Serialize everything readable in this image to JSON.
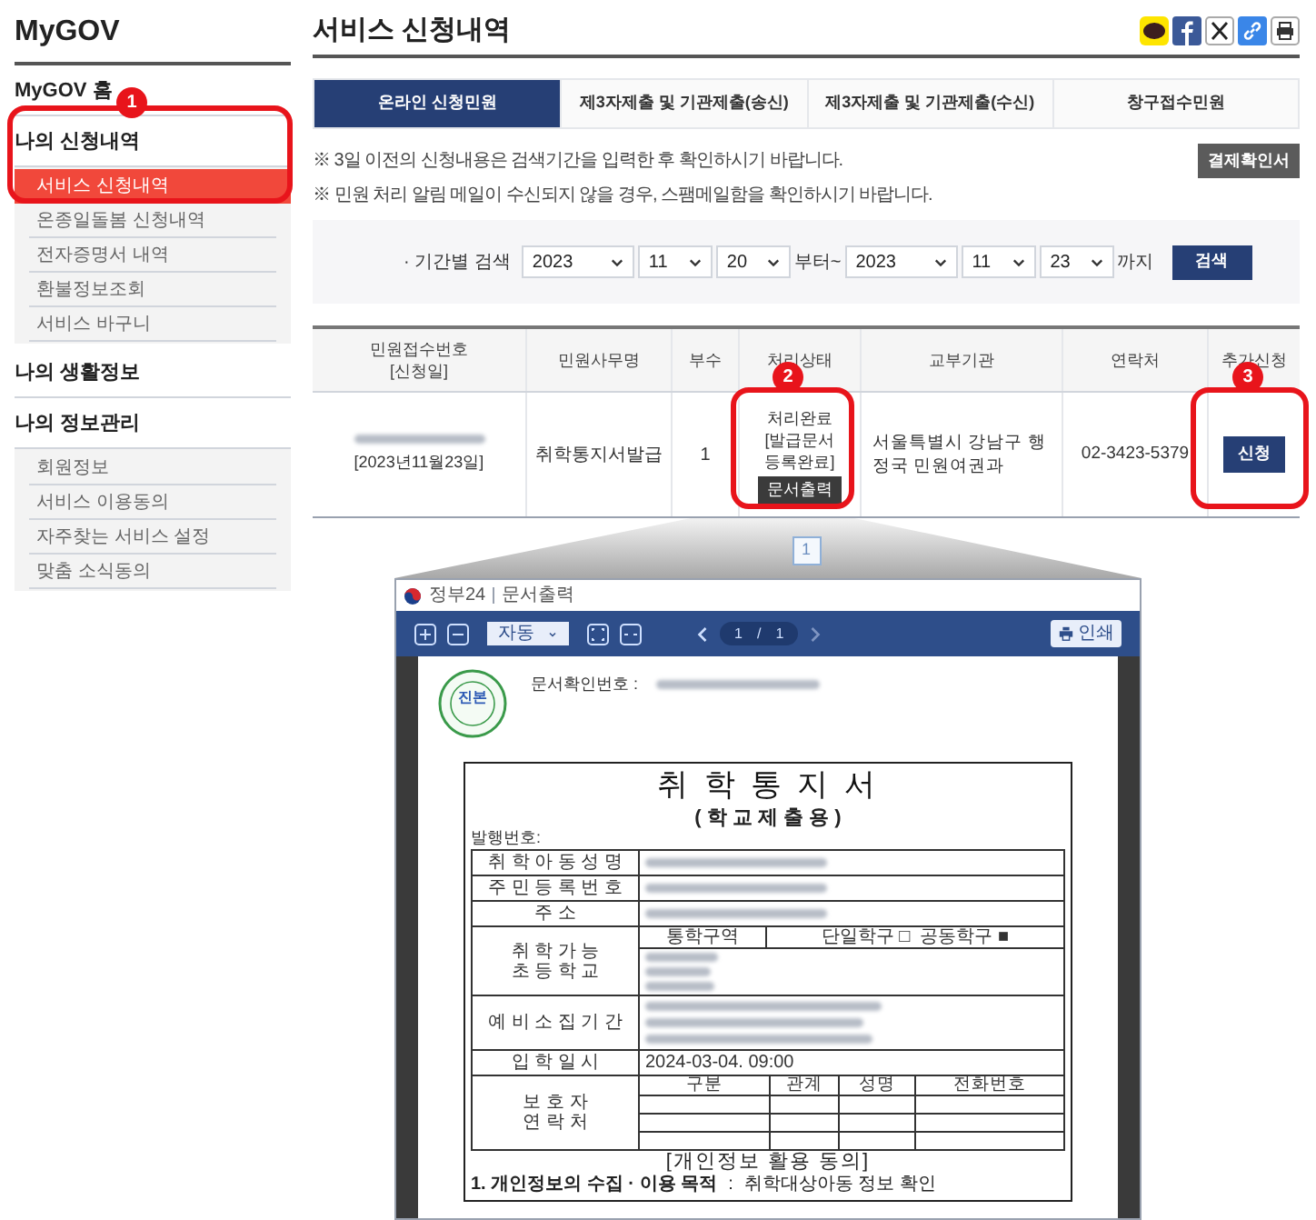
{
  "sidebar": {
    "title": "MyGOV",
    "items": [
      {
        "label": "MyGOV 홈"
      },
      {
        "label": "나의 신청내역",
        "children": [
          {
            "label": "서비스 신청내역",
            "selected": true
          },
          {
            "label": "온종일돌봄 신청내역",
            "selected": false
          },
          {
            "label": "전자증명서 내역",
            "selected": false
          },
          {
            "label": "환불정보조회",
            "selected": false
          },
          {
            "label": "서비스 바구니",
            "selected": false
          }
        ]
      },
      {
        "label": "나의 생활정보"
      },
      {
        "label": "나의 정보관리",
        "children": [
          {
            "label": "회원정보",
            "selected": false
          },
          {
            "label": "서비스 이용동의",
            "selected": false
          },
          {
            "label": "자주찾는 서비스 설정",
            "selected": false
          },
          {
            "label": "맞춤 소식동의",
            "selected": false
          }
        ]
      }
    ]
  },
  "page_title": "서비스 신청내역",
  "tabs": [
    {
      "label": "온라인 신청민원",
      "selected": true
    },
    {
      "label": "제3자제출 및 기관제출(송신)",
      "selected": false
    },
    {
      "label": "제3자제출 및 기관제출(수신)",
      "selected": false
    },
    {
      "label": "창구접수민원",
      "selected": false
    }
  ],
  "notices": [
    "※ 3일 이전의 신청내용은 검색기간을 입력한 후 확인하시기 바랍니다.",
    "※ 민원 처리 알림 메일이 수신되지 않을 경우, 스팸메일함을 확인하시기 바랍니다."
  ],
  "payment_button": "결제확인서",
  "search": {
    "label": "· 기간별 검색",
    "from": [
      "2023",
      "11",
      "20"
    ],
    "from_suffix": "부터~",
    "to": [
      "2023",
      "11",
      "23"
    ],
    "to_suffix": "까지",
    "button": "검색"
  },
  "table": {
    "columns": [
      [
        "민원접수번호",
        "[신청일]"
      ],
      [
        "민원사무명"
      ],
      [
        "부수"
      ],
      [
        "처리상태"
      ],
      [
        "교부기관"
      ],
      [
        "연락처"
      ],
      [
        "추가신청"
      ]
    ],
    "rows": [
      {
        "date": "[2023년11월23일]",
        "service": "취학통지서발급",
        "copies": "1",
        "status": "처리완료",
        "status_detail": "[발급문서 등록완료]",
        "print_button": "문서출력",
        "office": "서울특별시 강남구 행정국 민원여권과",
        "phone": "02-3423-5379",
        "apply_button": "신청"
      }
    ]
  },
  "pagination": [
    {
      "label": "1",
      "selected": true
    }
  ],
  "viewer": {
    "brand": "정부24",
    "title": "문서출력",
    "zoom": "자동",
    "page": "1",
    "page_separator": "/",
    "pages": "1",
    "print_button": "인쇄"
  },
  "document": {
    "confirm_label": "문서확인번호 :",
    "stamp": "진본",
    "title": "취 학 통 지 서",
    "subtitle": "( 학 교 제 출 용 )",
    "issue_label": "발행번호:",
    "rows": [
      {
        "kind": "blurred",
        "label": [
          "취 학 아 동 성 명"
        ]
      },
      {
        "kind": "blurred",
        "label": [
          "주 민 등 록 번 호"
        ]
      },
      {
        "kind": "blurred",
        "label": [
          "주 소"
        ]
      },
      {
        "kind": "school",
        "label": [
          "취 학 가 능",
          "초 등 학 교"
        ],
        "area_label": "통학구역",
        "options": "단일학구 □  공동학구 ■"
      },
      {
        "kind": "blurred_multi",
        "label": [
          "예 비 소 집 기 간"
        ]
      },
      {
        "kind": "text",
        "label": [
          "입 학 일 시"
        ],
        "value": "2024-03-04. 09:00"
      },
      {
        "kind": "guardian",
        "label": [
          "보 호 자",
          "연 락 처"
        ],
        "columns": [
          "구분",
          "관계",
          "성명",
          "전화번호"
        ]
      }
    ],
    "consent_title": "[개인정보 활용 동의]",
    "consent_items": [
      {
        "label": "1. 개인정보의 수집 · 이용 목적",
        "sep": ":",
        "value": "취학대상아동 정보 확인"
      }
    ]
  },
  "annotations": [
    "1",
    "2",
    "3"
  ]
}
